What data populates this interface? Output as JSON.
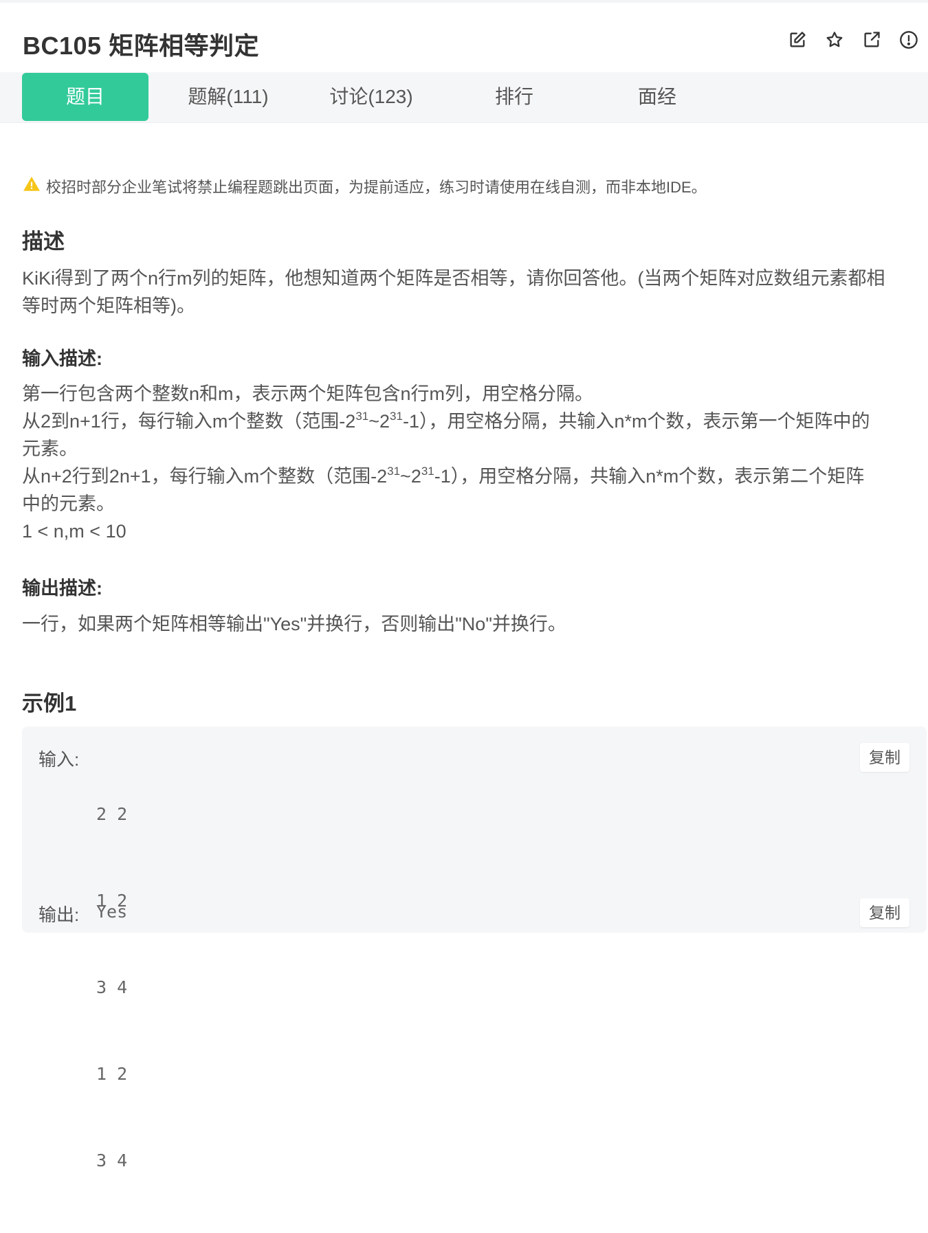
{
  "problem": {
    "title": "BC105  矩阵相等判定"
  },
  "toolbar_icons": [
    "edit-icon",
    "star-icon",
    "share-icon",
    "report-icon"
  ],
  "tabs": [
    {
      "label": "题目",
      "active": true
    },
    {
      "label": "题解(111)"
    },
    {
      "label": "讨论(123)"
    },
    {
      "label": "排行"
    },
    {
      "label": "面经"
    }
  ],
  "notice": "校招时部分企业笔试将禁止编程题跳出页面，为提前适应，练习时请使用在线自测，而非本地IDE。",
  "description": {
    "heading": "描述",
    "lines": [
      "KiKi得到了两个n行m列的矩阵，他想知道两个矩阵是否相等，请你回答他。(当两个矩阵对应数组元素都相",
      "等时两个矩阵相等)。"
    ]
  },
  "input_desc": {
    "heading": "输入描述:",
    "line1": "第一行包含两个整数n和m，表示两个矩阵包含n行m列，用空格分隔。",
    "line2": {
      "a": "从2到n+1行，每行输入m个整数（范围-2",
      "exp1": "31",
      "b": "~2",
      "exp2": "31",
      "c": "-1），用空格分隔，共输入n*m个数，表示第一个矩阵中的"
    },
    "line3": "元素。",
    "line4": {
      "a": "从n+2行到2n+1，每行输入m个整数（范围-2",
      "exp1": "31",
      "b": "~2",
      "exp2": "31",
      "c": "-1），用空格分隔，共输入n*m个数，表示第二个矩阵"
    },
    "line5": "中的元素。",
    "line6": "1 < n,m < 10"
  },
  "output_desc": {
    "heading": "输出描述:",
    "line1": "一行，如果两个矩阵相等输出\"Yes\"并换行，否则输出\"No\"并换行。"
  },
  "example": {
    "heading": "示例1",
    "input_label": "输入:",
    "input_lines": [
      "2 2",
      "1 2",
      "3 4",
      "1 2",
      "3 4"
    ],
    "output_label": "输出:",
    "output_value": "Yes",
    "copy_label": "复制"
  },
  "colors": {
    "accent": "#32ca99",
    "warning": "#f5c518"
  }
}
